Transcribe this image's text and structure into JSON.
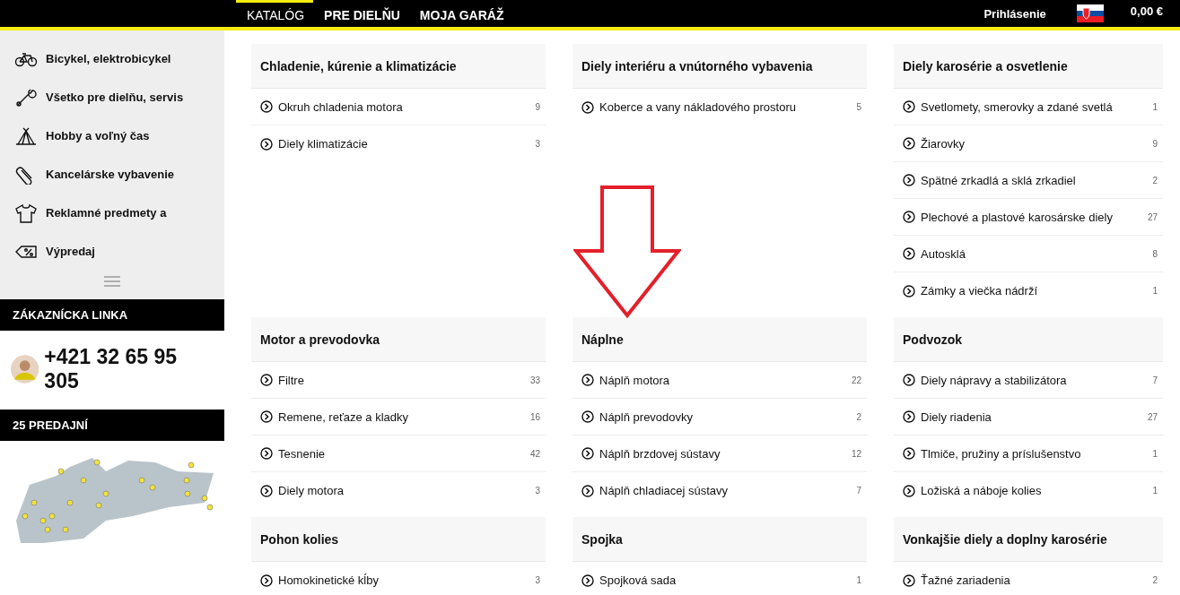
{
  "top_nav": {
    "tabs": [
      {
        "label": "KATALÓG",
        "selected": true
      },
      {
        "label": "PRE DIELŇU",
        "selected": false
      },
      {
        "label": "MOJA GARÁŽ",
        "selected": false
      }
    ],
    "login": "Prihlásenie",
    "cart_total": "0,00 €"
  },
  "sidebar": {
    "items": [
      {
        "label": "Bicykel, elektrobicykel",
        "kind": "bicycle"
      },
      {
        "label": "Všetko pre dielňu, servis",
        "kind": "wrench"
      },
      {
        "label": "Hobby a voľný čas",
        "kind": "tent"
      },
      {
        "label": "Kancelárske vybavenie",
        "kind": "paperclip"
      },
      {
        "label": "Reklamné predmety a",
        "kind": "tshirt"
      },
      {
        "label": "Výpredaj",
        "kind": "tag"
      }
    ],
    "hotline_title": "ZÁKAZNÍCKA LINKA",
    "phone": "+421 32 65 95 305",
    "stores_title": "25 PREDAJNÍ"
  },
  "categories": [
    {
      "title": "Chladenie, kúrenie a klimatizácie",
      "items": [
        {
          "label": "Okruh chladenia motora",
          "count": "9"
        },
        {
          "label": "Diely klimatizácie",
          "count": "3"
        }
      ]
    },
    {
      "title": "Diely interiéru a vnútorného vybavenia",
      "items": [
        {
          "label": "Koberce a vany nákladového prostoru",
          "count": "5"
        }
      ]
    },
    {
      "title": "Diely karosérie a osvetlenie",
      "items": [
        {
          "label": "Svetlomety, smerovky a zdané svetlá",
          "count": "1"
        },
        {
          "label": "Žiarovky",
          "count": "9"
        },
        {
          "label": "Spätné zrkadlá a sklá zrkadiel",
          "count": "2"
        },
        {
          "label": "Plechové a plastové karosárske diely",
          "count": "27"
        },
        {
          "label": "Autosklá",
          "count": "8"
        },
        {
          "label": "Zámky a viečka nádrží",
          "count": "1"
        }
      ]
    },
    {
      "title": "Motor a prevodovka",
      "items": [
        {
          "label": "Filtre",
          "count": "33"
        },
        {
          "label": "Remene, reťaze a kladky",
          "count": "16"
        },
        {
          "label": "Tesnenie",
          "count": "42"
        },
        {
          "label": "Diely motora",
          "count": "3"
        }
      ]
    },
    {
      "title": "Náplne",
      "items": [
        {
          "label": "Náplň motora",
          "count": "22"
        },
        {
          "label": "Náplň prevodovky",
          "count": "2"
        },
        {
          "label": "Náplň brzdovej sústavy",
          "count": "12"
        },
        {
          "label": "Náplň chladiacej sústavy",
          "count": "7"
        }
      ]
    },
    {
      "title": "Podvozok",
      "items": [
        {
          "label": "Diely nápravy a stabilizátora",
          "count": "7"
        },
        {
          "label": "Diely riadenia",
          "count": "27"
        },
        {
          "label": "Tlmiče, pružiny a príslušenstvo",
          "count": "1"
        },
        {
          "label": "Ložiská a náboje kolies",
          "count": "1"
        }
      ]
    },
    {
      "title": "Pohon kolies",
      "items": [
        {
          "label": "Homokinetické kĺby",
          "count": "3"
        }
      ]
    },
    {
      "title": "Spojka",
      "items": [
        {
          "label": "Spojková sada",
          "count": "1"
        }
      ]
    },
    {
      "title": "Vonkajšie diely a doplny karosérie",
      "items": [
        {
          "label": "Ťažné zariadenia",
          "count": "2"
        }
      ]
    }
  ]
}
